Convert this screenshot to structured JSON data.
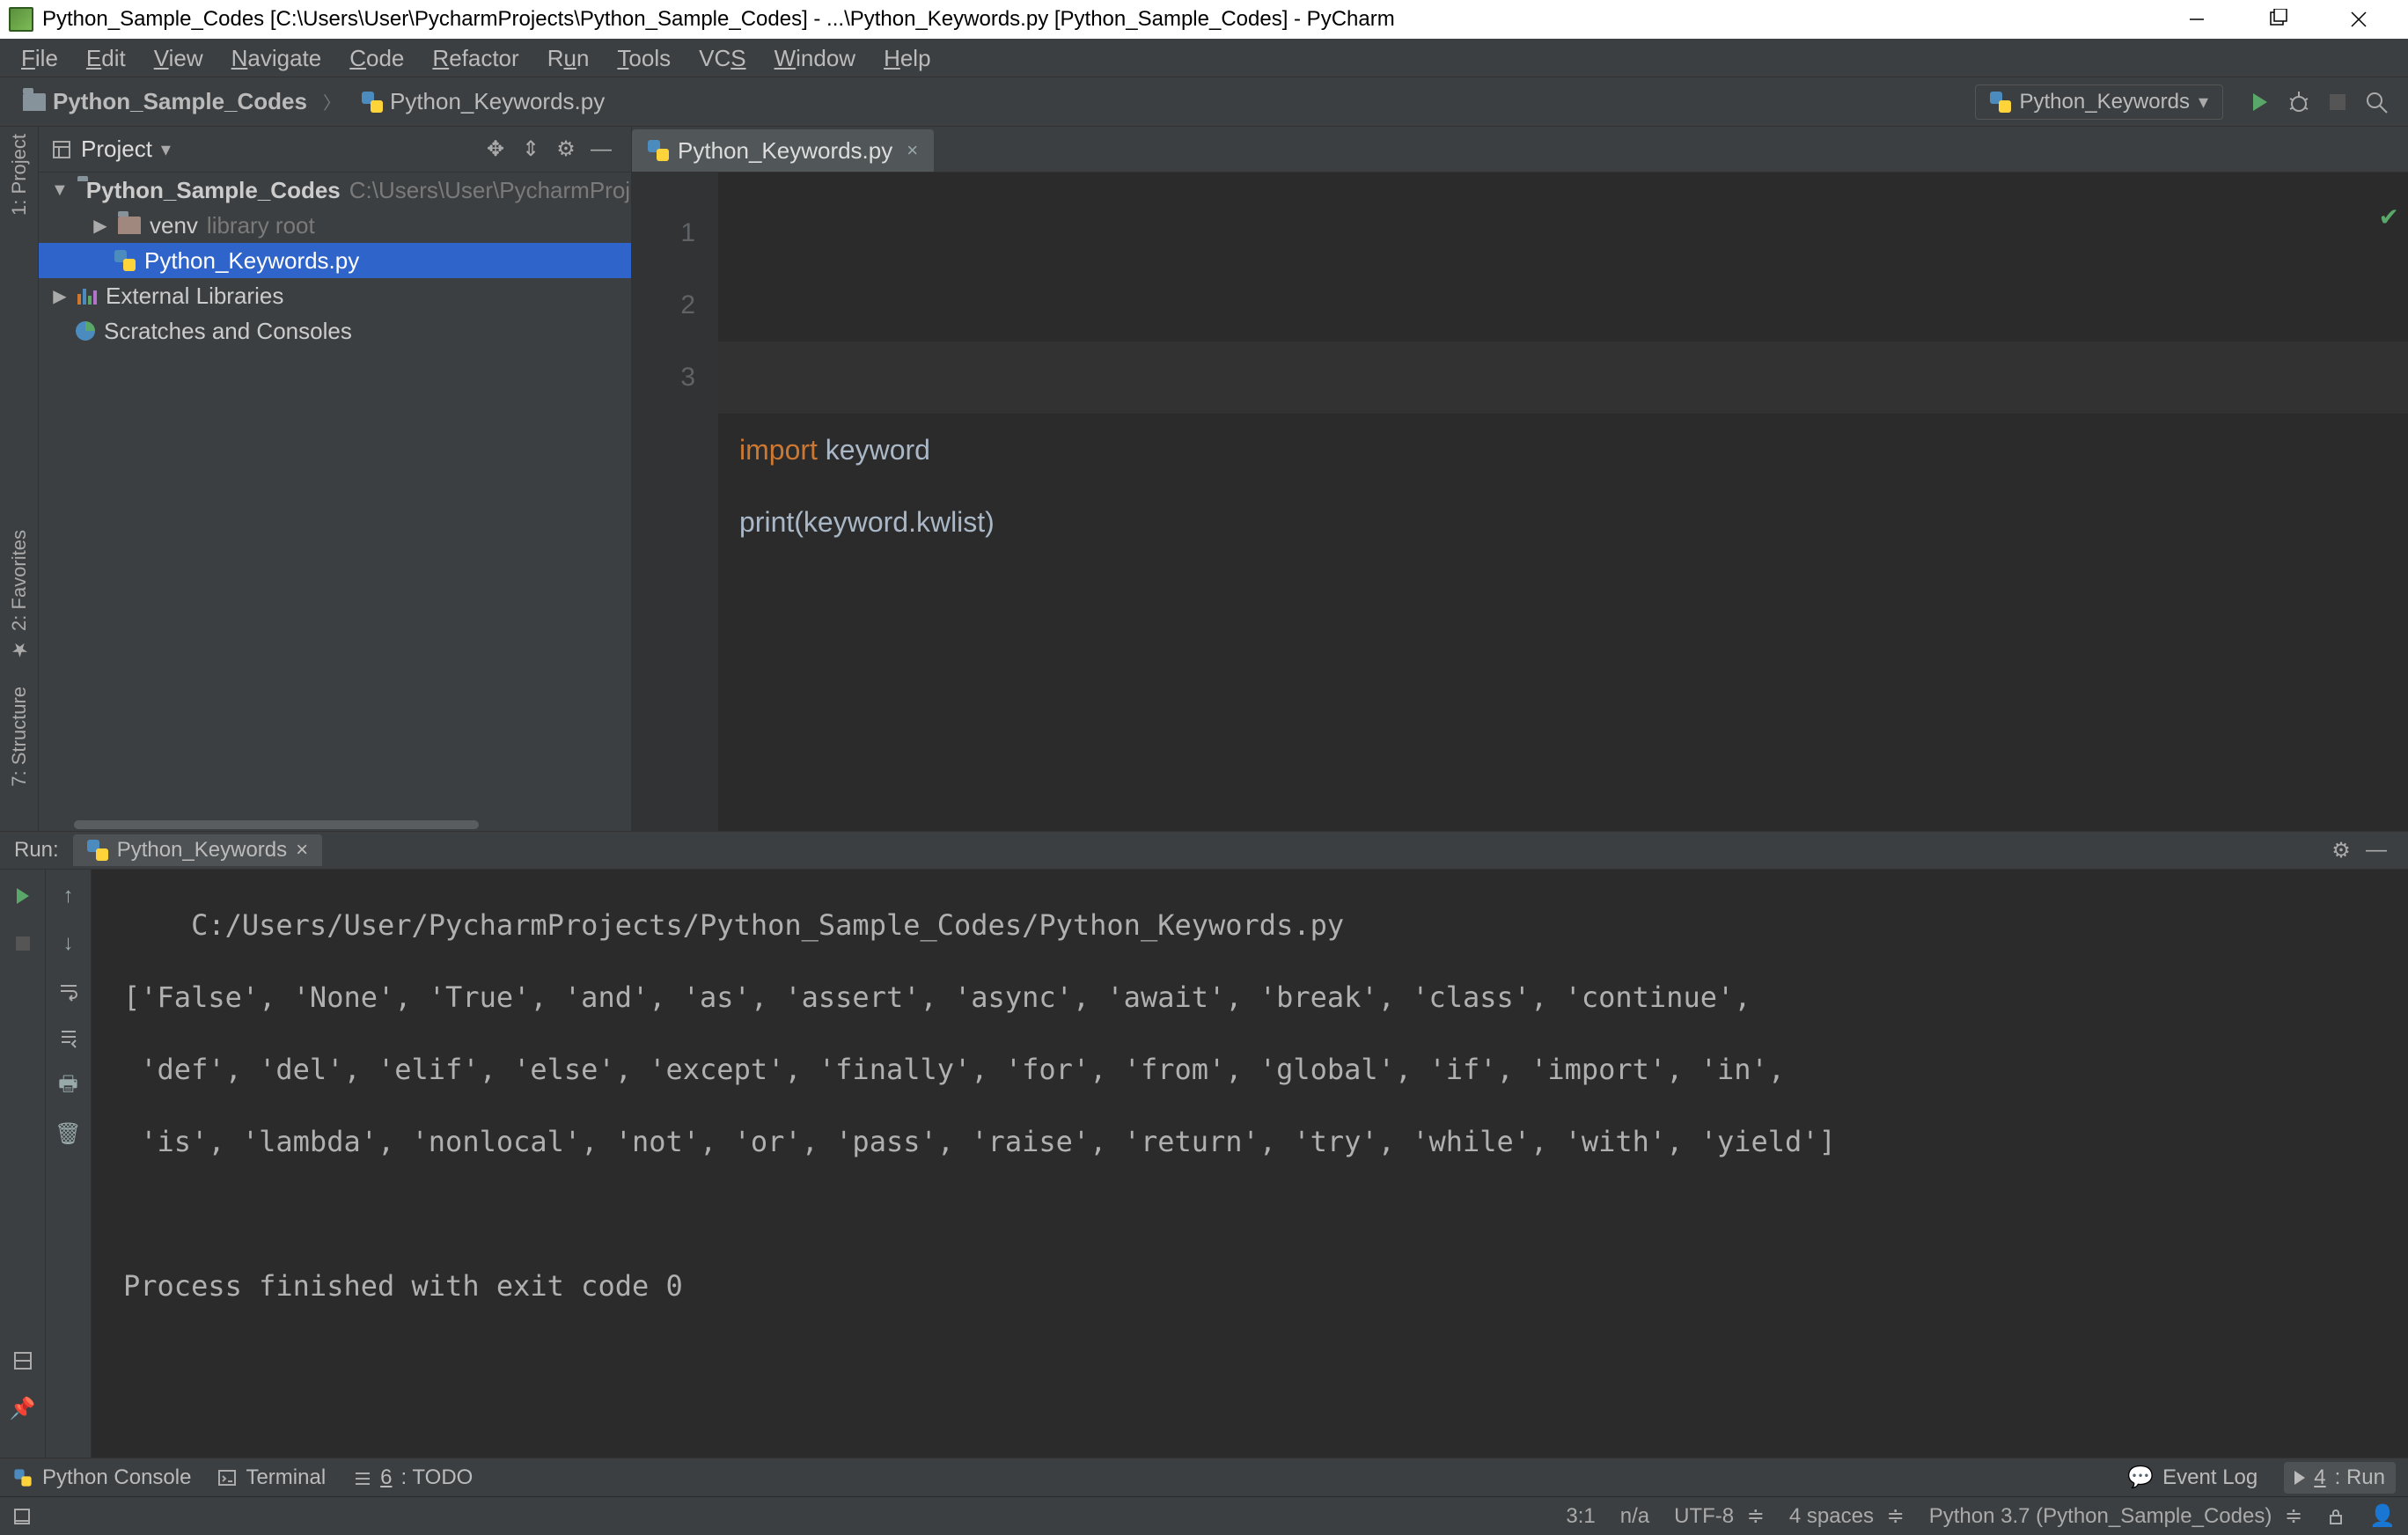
{
  "titlebar": {
    "text": "Python_Sample_Codes [C:\\Users\\User\\PycharmProjects\\Python_Sample_Codes] - ...\\Python_Keywords.py [Python_Sample_Codes] - PyCharm"
  },
  "menu": [
    "File",
    "Edit",
    "View",
    "Navigate",
    "Code",
    "Refactor",
    "Run",
    "Tools",
    "VCS",
    "Window",
    "Help"
  ],
  "breadcrumb": {
    "project": "Python_Sample_Codes",
    "file": "Python_Keywords.py"
  },
  "run_config": {
    "name": "Python_Keywords"
  },
  "project_panel": {
    "title": "Project",
    "items": [
      {
        "kind": "root",
        "arrow": "▼",
        "label": "Python_Sample_Codes",
        "path": "C:\\Users\\User\\PycharmProjects"
      },
      {
        "kind": "folder",
        "arrow": "▶",
        "label": "venv",
        "note": "library root",
        "indent": 1
      },
      {
        "kind": "pyfile",
        "arrow": "",
        "label": "Python_Keywords.py",
        "indent": 1,
        "selected": true
      },
      {
        "kind": "lib",
        "arrow": "▶",
        "label": "External Libraries",
        "indent": 0
      },
      {
        "kind": "scratch",
        "arrow": "",
        "label": "Scratches and Consoles",
        "indent": 0
      }
    ]
  },
  "editor": {
    "tab": "Python_Keywords.py",
    "gutter": [
      "1",
      "2",
      "3"
    ],
    "code": {
      "l1_kw": "import",
      "l1_rest": " keyword",
      "l2_fn": "print",
      "l2_rest": "(keyword.kwlist)"
    }
  },
  "run_panel": {
    "label": "Run:",
    "tab": "Python_Keywords",
    "console": "    C:/Users/User/PycharmProjects/Python_Sample_Codes/Python_Keywords.py\n['False', 'None', 'True', 'and', 'as', 'assert', 'async', 'await', 'break', 'class', 'continue',\n 'def', 'del', 'elif', 'else', 'except', 'finally', 'for', 'from', 'global', 'if', 'import', 'in',\n 'is', 'lambda', 'nonlocal', 'not', 'or', 'pass', 'raise', 'return', 'try', 'while', 'with', 'yield']\n\nProcess finished with exit code 0"
  },
  "left_rail": [
    {
      "label": "1: Project"
    },
    {
      "label": "2: Favorites"
    },
    {
      "label": "7: Structure"
    }
  ],
  "bottombar": {
    "left": [
      {
        "label": "Python Console"
      },
      {
        "label": "Terminal"
      },
      {
        "label": "6: TODO"
      }
    ],
    "right": [
      {
        "label": "Event Log"
      },
      {
        "label": "4: Run",
        "active": true
      }
    ]
  },
  "status": {
    "caret": "3:1",
    "na": "n/a",
    "encoding": "UTF-8",
    "indent": "4 spaces",
    "interpreter": "Python 3.7 (Python_Sample_Codes)"
  }
}
